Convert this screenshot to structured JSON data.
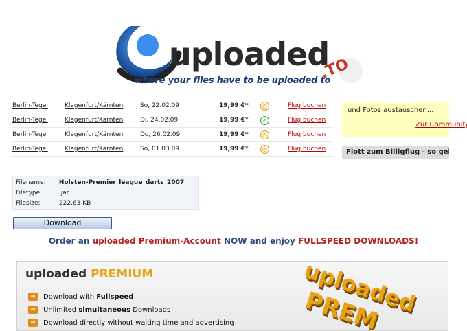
{
  "logo": {
    "brand": "uploaded",
    "tagline": "where your files have to be uploaded to",
    "tld": ".TO"
  },
  "flights": [
    {
      "from": "Berlin-Tegel",
      "to": "Klagenfurt/Kärnten",
      "date": "So, 22.02.09",
      "price": "19,99 €*",
      "status": "clock",
      "book": "Flug buchen"
    },
    {
      "from": "Berlin-Tegel",
      "to": "Klagenfurt/Kärnten",
      "date": "Di, 24.02.09",
      "price": "19,99 €*",
      "status": "ok",
      "book": "Flug buchen"
    },
    {
      "from": "Berlin-Tegel",
      "to": "Klagenfurt/Kärnten",
      "date": "Do, 26.02.09",
      "price": "19,99 €*",
      "status": "clock",
      "book": "Flug buchen"
    },
    {
      "from": "Berlin-Tegel",
      "to": "Klagenfurt/Kärnten",
      "date": "So, 01.03.09",
      "price": "19,99 €*",
      "status": "clock",
      "book": "Flug buchen"
    }
  ],
  "ads": {
    "yellow_text": "und Fotos austauschen...",
    "yellow_link": "Zur Community",
    "grey_text": "Flott zum Billigflug - so geht's"
  },
  "file": {
    "name_label": "Filename:",
    "name": "Holsten-Premier_league_darts_2007",
    "type_label": "Filetype:",
    "type": ".jar",
    "size_label": "Filesize:",
    "size": "222.63 KB"
  },
  "download_label": "Download",
  "promo": {
    "p1": "Order an ",
    "p2": "uploaded Premium-Account",
    "p3": " NOW and enjoy ",
    "p4": "FULLSPEED DOWNLOADS!"
  },
  "premium": {
    "logo_word": "uploaded",
    "logo_gold": "PREMIUM",
    "features": [
      {
        "pre": "Download with ",
        "bold": "Fullspeed",
        "post": ""
      },
      {
        "pre": "Unlimited ",
        "bold": "simultaneous",
        "post": " Downloads"
      },
      {
        "pre": "Download directly without waiting time and advertising",
        "bold": "",
        "post": ""
      }
    ],
    "graphic_line1": "uploaded",
    "graphic_line2": "PREM"
  },
  "colors": {
    "brand_blue": "#1f5aa6",
    "accent_red": "#c00000",
    "premium_gold": "#e8a317"
  }
}
